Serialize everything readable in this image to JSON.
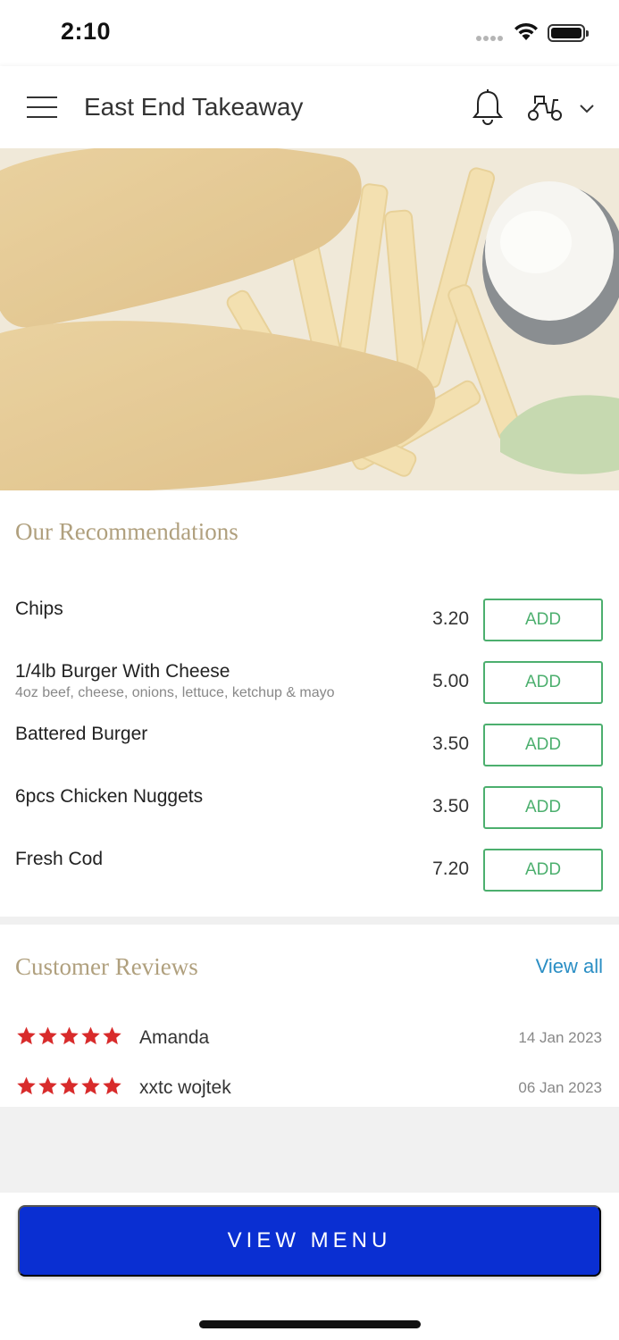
{
  "status_bar": {
    "time": "2:10"
  },
  "header": {
    "title": "East End Takeaway"
  },
  "recommendations": {
    "title": "Our Recommendations",
    "items": [
      {
        "name": "Chips",
        "description": "",
        "price": "3.20",
        "button": "ADD"
      },
      {
        "name": "1/4lb Burger With Cheese",
        "description": "4oz beef, cheese, onions, lettuce, ketchup & mayo",
        "price": "5.00",
        "button": "ADD"
      },
      {
        "name": "Battered Burger",
        "description": "",
        "price": "3.50",
        "button": "ADD"
      },
      {
        "name": "6pcs Chicken Nuggets",
        "description": "",
        "price": "3.50",
        "button": "ADD"
      },
      {
        "name": "Fresh Cod",
        "description": "",
        "price": "7.20",
        "button": "ADD"
      }
    ]
  },
  "reviews": {
    "title": "Customer Reviews",
    "view_all": "View all",
    "items": [
      {
        "name": "Amanda",
        "date": "14 Jan 2023",
        "rating": 5
      },
      {
        "name": "xxtc wojtek",
        "date": "06 Jan 2023",
        "rating": 5
      }
    ]
  },
  "footer": {
    "view_menu": "VIEW MENU"
  },
  "colors": {
    "accent_gold": "#b0a07e",
    "add_green": "#4caf6e",
    "star_red": "#d82b2b",
    "link_blue": "#2a8ec4",
    "primary_blue": "#0a2fd2"
  },
  "icons": [
    "menu-icon",
    "bell-icon",
    "scooter-icon",
    "chevron-down-icon",
    "star-icon",
    "wifi-icon",
    "battery-icon"
  ]
}
